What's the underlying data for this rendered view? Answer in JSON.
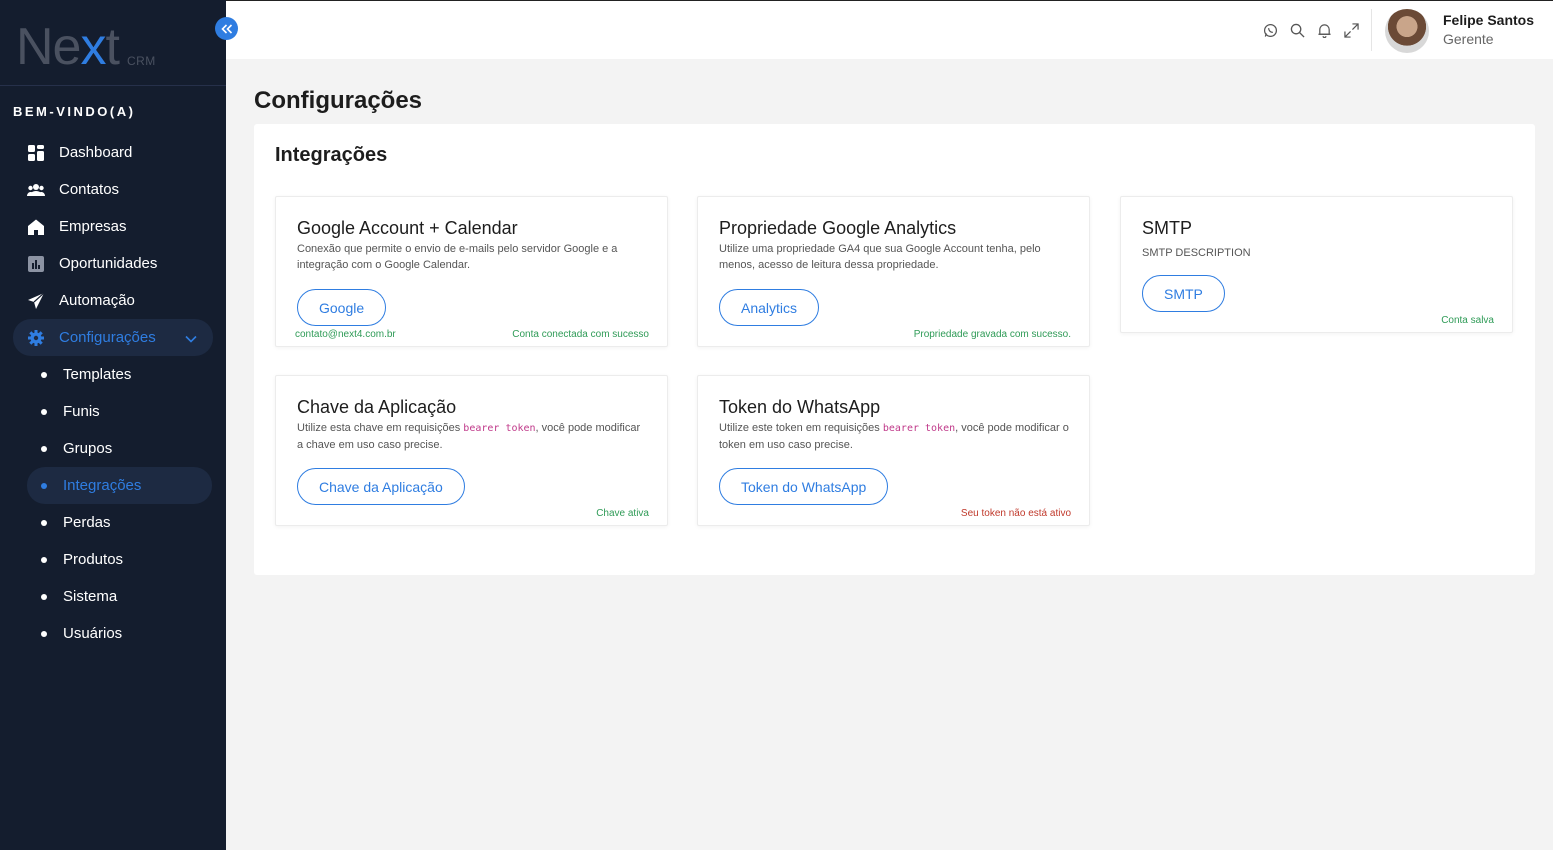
{
  "brand": {
    "logo_pre": "Ne",
    "logo_x": "x",
    "logo_post": "t",
    "logo_sub": "CRM"
  },
  "sidebar": {
    "welcome": "BEM-VINDO(A)",
    "items": [
      {
        "label": "Dashboard",
        "icon": "grid-icon"
      },
      {
        "label": "Contatos",
        "icon": "users-icon"
      },
      {
        "label": "Empresas",
        "icon": "home-icon"
      },
      {
        "label": "Oportunidades",
        "icon": "chart-icon"
      },
      {
        "label": "Automação",
        "icon": "send-icon"
      },
      {
        "label": "Configurações",
        "icon": "gear-icon",
        "active": true
      }
    ],
    "subitems": [
      {
        "label": "Templates"
      },
      {
        "label": "Funis"
      },
      {
        "label": "Grupos"
      },
      {
        "label": "Integrações",
        "active": true
      },
      {
        "label": "Perdas"
      },
      {
        "label": "Produtos"
      },
      {
        "label": "Sistema"
      },
      {
        "label": "Usuários"
      }
    ]
  },
  "topbar": {
    "icons": [
      "whatsapp-icon",
      "search-icon",
      "bell-icon",
      "expand-icon"
    ],
    "user_name": "Felipe Santos",
    "user_role": "Gerente"
  },
  "page": {
    "title": "Configurações",
    "section_title": "Integrações"
  },
  "cards": {
    "google": {
      "title": "Google Account + Calendar",
      "desc": "Conexão que permite o envio de e-mails pelo servidor Google e a integração com o Google Calendar.",
      "button": "Google",
      "email": "contato@next4.com.br",
      "status": "Conta conectada com sucesso"
    },
    "analytics": {
      "title": "Propriedade Google Analytics",
      "desc": "Utilize uma propriedade GA4 que sua Google Account tenha, pelo menos, acesso de leitura dessa propriedade.",
      "button": "Analytics",
      "status": "Propriedade gravada com sucesso."
    },
    "smtp": {
      "title": "SMTP",
      "desc": "SMTP DESCRIPTION",
      "button": "SMTP",
      "status": "Conta salva"
    },
    "app_key": {
      "title": "Chave da Aplicação",
      "desc_pre": "Utilize esta chave em requisições ",
      "desc_code": "bearer token",
      "desc_post": ", você pode modificar a chave em uso caso precise.",
      "button": "Chave da Aplicação",
      "status": "Chave ativa"
    },
    "whatsapp": {
      "title": "Token do WhatsApp",
      "desc_pre": "Utilize este token em requisições ",
      "desc_code": "bearer token",
      "desc_post": ", você pode modificar o token em uso caso precise.",
      "button": "Token do WhatsApp",
      "status": "Seu token não está ativo"
    }
  },
  "colors": {
    "accent": "#2f7de1",
    "success": "#2f9b57",
    "error": "#c0392b",
    "sidebar": "#141d2e"
  }
}
